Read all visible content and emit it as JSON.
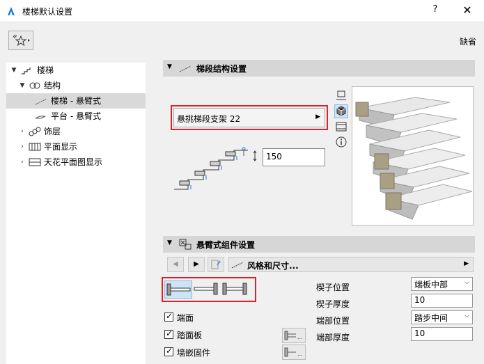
{
  "window": {
    "title": "楼梯默认设置",
    "help": "?",
    "close": "✕"
  },
  "toolbar": {
    "default_label": "缺省"
  },
  "tree": {
    "items": [
      {
        "label": "楼梯",
        "expanded": true
      },
      {
        "label": "结构",
        "expanded": true
      },
      {
        "label": "楼梯 - 悬臂式",
        "selected": true
      },
      {
        "label": "平台 - 悬臂式"
      },
      {
        "label": "饰层",
        "expanded": false
      },
      {
        "label": "平面显示",
        "expanded": false
      },
      {
        "label": "天花平面图显示",
        "expanded": false
      }
    ]
  },
  "structure_section": {
    "title": "梯段结构设置",
    "support_dropdown": "悬挑梯段支架 22",
    "thickness_value": "150"
  },
  "cantilever_section": {
    "title": "悬臂式组件设置",
    "nav_dropdown": "风格和尺寸..."
  },
  "checkboxes": [
    {
      "label": "端面",
      "checked": true
    },
    {
      "label": "踏面板",
      "checked": true
    },
    {
      "label": "墙嵌固件",
      "checked": true
    }
  ],
  "fields": [
    {
      "label": "楔子位置",
      "type": "select",
      "value": "端板中部"
    },
    {
      "label": "楔子厚度",
      "type": "input",
      "value": "10"
    },
    {
      "label": "端部位置",
      "type": "select",
      "value": "踏步中间"
    },
    {
      "label": "端部厚度",
      "type": "input",
      "value": "10"
    }
  ],
  "colors": {
    "highlight_red": "#e0202a",
    "selected_blue": "#cde4f7",
    "section_header": "#d6d6d6"
  }
}
